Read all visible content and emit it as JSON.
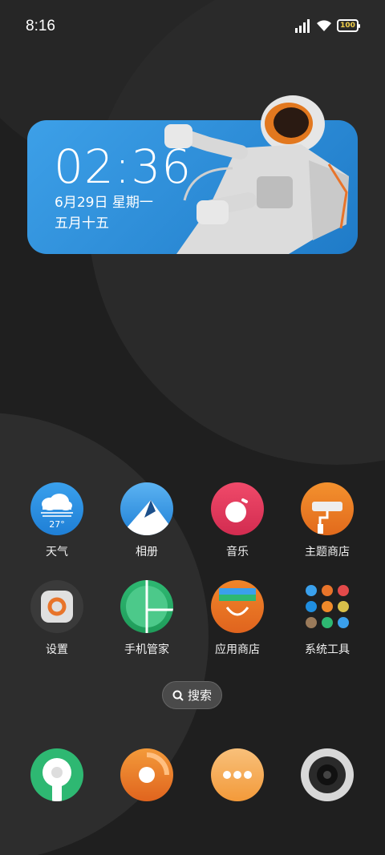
{
  "status": {
    "time": "8:16",
    "battery": "100"
  },
  "widget": {
    "clock": "02:36",
    "date": "6月29日 星期一",
    "lunar": "五月十五"
  },
  "apps": [
    {
      "label": "天气",
      "temp": "27°"
    },
    {
      "label": "相册"
    },
    {
      "label": "音乐"
    },
    {
      "label": "主题商店"
    },
    {
      "label": "设置"
    },
    {
      "label": "手机管家"
    },
    {
      "label": "应用商店"
    },
    {
      "label": "系统工具"
    }
  ],
  "search": {
    "label": "搜索"
  },
  "colors": {
    "accent": "#e8742a",
    "widget": "#2e8fda"
  }
}
